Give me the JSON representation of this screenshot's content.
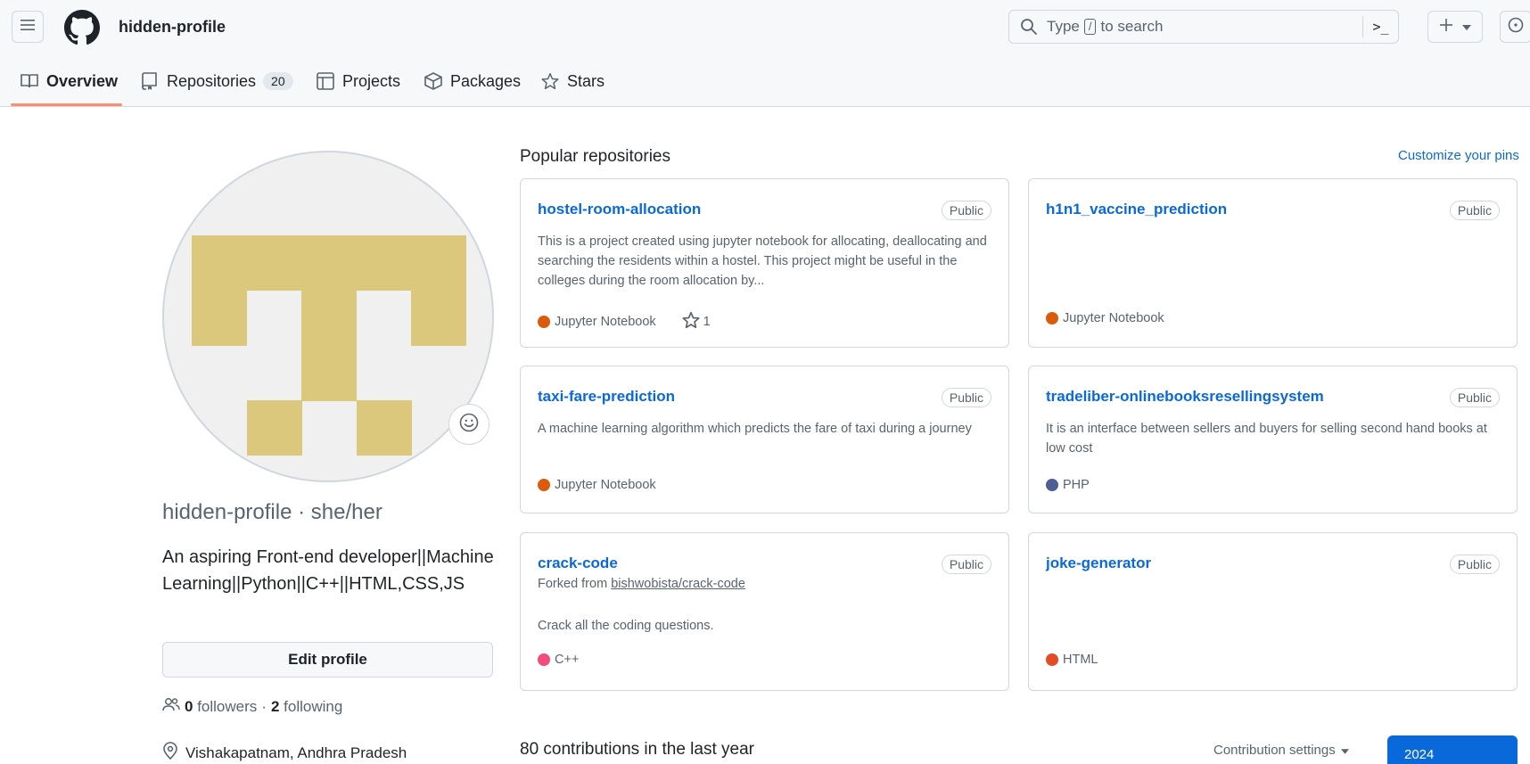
{
  "header": {
    "username": "hidden-profile",
    "search": {
      "prefix": "Type",
      "key": "/",
      "suffix": "to search"
    }
  },
  "tabs": [
    {
      "label": "Overview",
      "icon": "book-icon"
    },
    {
      "label": "Repositories",
      "icon": "repo-icon",
      "count": "20"
    },
    {
      "label": "Projects",
      "icon": "table-icon"
    },
    {
      "label": "Packages",
      "icon": "package-icon"
    },
    {
      "label": "Stars",
      "icon": "star-icon"
    }
  ],
  "profile": {
    "name_line": "hidden-profile · she/her",
    "bio": "An aspiring Front-end developer||Machine Learning||Python||C++||HTML,CSS,JS",
    "edit_label": "Edit profile",
    "followers_count": "0",
    "followers_label": "followers",
    "separator": "·",
    "following_count": "2",
    "following_label": "following",
    "location": "Vishakapatnam, Andhra Pradesh",
    "avatar_color": "#dcc87c"
  },
  "popular": {
    "title": "Popular repositories",
    "customize": "Customize your pins",
    "repos": [
      {
        "name": "hostel-room-allocation",
        "visibility": "Public",
        "description": "This is a project created using jupyter notebook for allocating, deallocating and searching the residents within a hostel. This project might be useful in the colleges during the room allocation by...",
        "language": "Jupyter Notebook",
        "lang_color": "#DA5B0B",
        "stars": "1"
      },
      {
        "name": "h1n1_vaccine_prediction",
        "visibility": "Public",
        "description": "",
        "language": "Jupyter Notebook",
        "lang_color": "#DA5B0B"
      },
      {
        "name": "taxi-fare-prediction",
        "visibility": "Public",
        "description": "A machine learning algorithm which predicts the fare of taxi during a journey",
        "language": "Jupyter Notebook",
        "lang_color": "#DA5B0B"
      },
      {
        "name": "tradeliber-onlinebooksresellingsystem",
        "visibility": "Public",
        "description": "It is an interface between sellers and buyers for selling second hand books at low cost",
        "language": "PHP",
        "lang_color": "#4F5D95"
      },
      {
        "name": "crack-code",
        "visibility": "Public",
        "forked_prefix": "Forked from",
        "forked_from": "bishwobista/crack-code",
        "description": "Crack all the coding questions.",
        "language": "C++",
        "lang_color": "#f34b7d"
      },
      {
        "name": "joke-generator",
        "visibility": "Public",
        "description": "",
        "language": "HTML",
        "lang_color": "#e34c26"
      }
    ]
  },
  "contributions": {
    "title": "80 contributions in the last year",
    "settings": "Contribution settings",
    "year": "2024"
  }
}
